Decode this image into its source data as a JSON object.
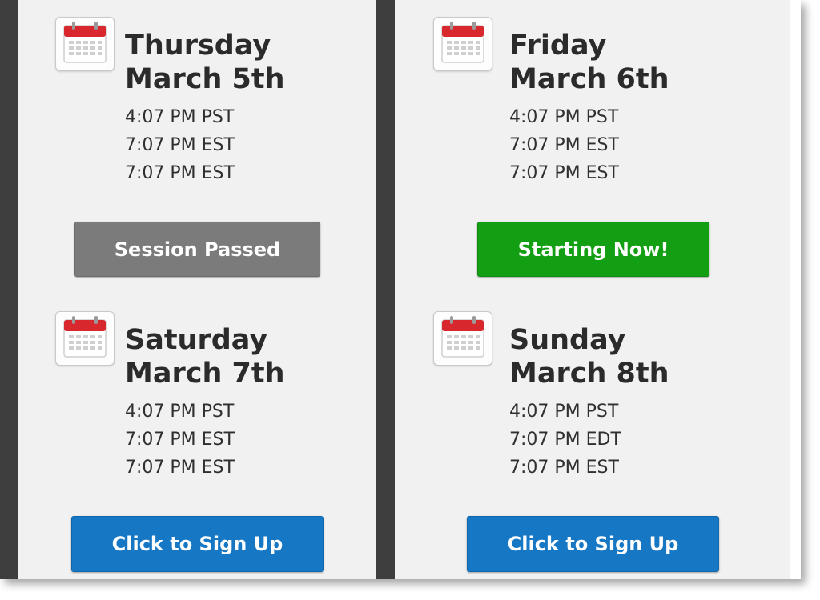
{
  "colors": {
    "divider": "#3e3e3e",
    "panel_background": "#f1f1f1",
    "calendar_red": "#d9272e",
    "passed_button": "#7b7b7b",
    "now_button": "#129f14",
    "signup_button": "#1677c4"
  },
  "sessions": [
    {
      "day": "Thursday",
      "date": "March 5th",
      "times": [
        "4:07 PM PST",
        "7:07 PM EST",
        "7:07 PM EST"
      ],
      "button_label": "Session Passed",
      "status": "passed",
      "icon": "calendar-icon"
    },
    {
      "day": "Friday",
      "date": "March 6th",
      "times": [
        "4:07 PM PST",
        "7:07 PM EST",
        "7:07 PM EST"
      ],
      "button_label": "Starting Now!",
      "status": "live",
      "icon": "calendar-icon"
    },
    {
      "day": "Saturday",
      "date": "March 7th",
      "times": [
        "4:07 PM PST",
        "7:07 PM EST",
        "7:07 PM EST"
      ],
      "button_label": "Click to Sign Up",
      "status": "upcoming",
      "icon": "calendar-icon"
    },
    {
      "day": "Sunday",
      "date": "March 8th",
      "times": [
        "4:07 PM PST",
        "7:07 PM EDT",
        "7:07 PM EST"
      ],
      "button_label": "Click to Sign Up",
      "status": "upcoming",
      "icon": "calendar-icon"
    }
  ]
}
